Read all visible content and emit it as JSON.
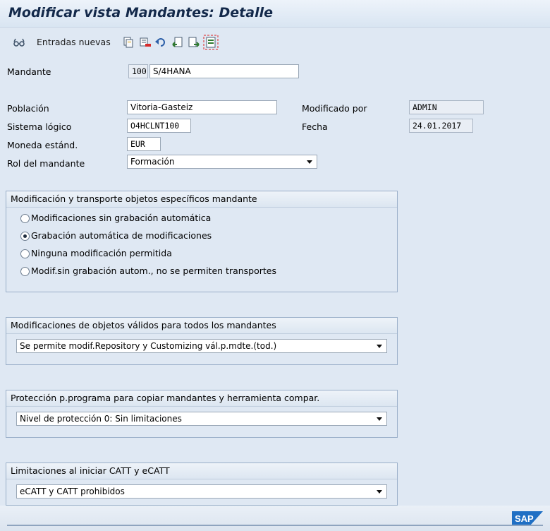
{
  "header": {
    "title": "Modificar vista Mandantes: Detalle"
  },
  "toolbar": {
    "new_entries_label": "Entradas nuevas",
    "icons": [
      "glasses-icon",
      "copy-icon",
      "delete-icon",
      "undo-icon",
      "previous-entry-icon",
      "next-entry-icon",
      "select-all-icon"
    ]
  },
  "client": {
    "label": "Mandante",
    "number": "100",
    "name": "S/4HANA"
  },
  "fields": {
    "city_label": "Población",
    "city_value": "Vitoria-Gasteiz",
    "logical_system_label": "Sistema lógico",
    "logical_system_value": "O4HCLNT100",
    "currency_label": "Moneda estánd.",
    "currency_value": "EUR",
    "role_label": "Rol del mandante",
    "role_value": "Formación",
    "changed_by_label": "Modificado por",
    "changed_by_value": "ADMIN",
    "date_label": "Fecha",
    "date_value": "24.01.2017"
  },
  "group_transport": {
    "title": "Modificación y transporte objetos específicos mandante",
    "options": [
      {
        "label": "Modificaciones sin grabación automática",
        "selected": false
      },
      {
        "label": "Grabación automática de modificaciones",
        "selected": true
      },
      {
        "label": "Ninguna modificación permitida",
        "selected": false
      },
      {
        "label": "Modif.sin grabación autom., no se permiten transportes",
        "selected": false
      }
    ]
  },
  "group_cross_client": {
    "title": "Modificaciones de objetos válidos para todos los mandantes",
    "value": "Se permite modif.Repository y Customizing vál.p.mdte.(tod.)"
  },
  "group_protection": {
    "title": "Protección p.programa para copiar mandantes y herramienta compar.",
    "value": "Nivel de protección 0: Sin limitaciones"
  },
  "group_catt": {
    "title": "Limitaciones al iniciar CATT y eCATT",
    "value": "eCATT y CATT prohibidos"
  },
  "footer": {
    "logo_text": "SAP",
    "logo_color": "#1f6fc4"
  }
}
